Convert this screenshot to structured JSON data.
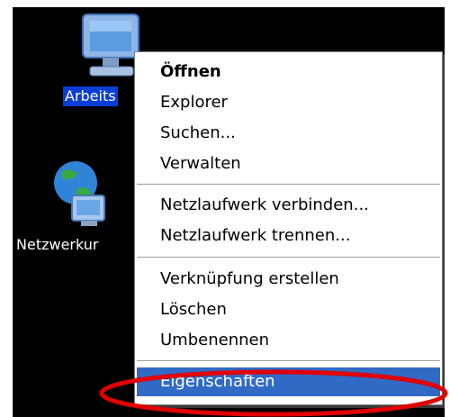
{
  "desktop": {
    "icons": [
      {
        "label": "Arbeits",
        "icon": "my-computer-icon"
      },
      {
        "label": "Netzwerkur",
        "icon": "network-places-icon"
      }
    ]
  },
  "context_menu": {
    "items": [
      {
        "label": "Öffnen",
        "bold": true
      },
      {
        "label": "Explorer"
      },
      {
        "label": "Suchen..."
      },
      {
        "label": "Verwalten"
      },
      {
        "label": "Netzlaufwerk verbinden..."
      },
      {
        "label": "Netzlaufwerk trennen..."
      },
      {
        "label": "Verknüpfung erstellen"
      },
      {
        "label": "Löschen"
      },
      {
        "label": "Umbenennen"
      },
      {
        "label": "Eigenschaften",
        "highlighted": true
      }
    ]
  },
  "colors": {
    "desktop_bg": "#000000",
    "highlight": "#316ac5",
    "selected_label_bg": "#0b3ed8",
    "annotation": "#e00000"
  }
}
